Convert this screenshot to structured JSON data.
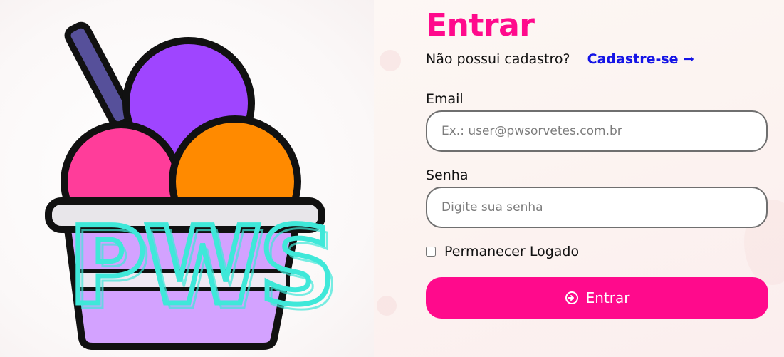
{
  "login": {
    "title": "Entrar",
    "signup_prompt": "Não possui cadastro?",
    "signup_link": "Cadastre-se",
    "signup_arrow": "➞",
    "email_label": "Email",
    "email_placeholder": "Ex.: user@pwsorvetes.com.br",
    "password_label": "Senha",
    "password_placeholder": "Digite sua senha",
    "remember_label": "Permanecer Logado",
    "remember_checked": false,
    "submit_label": "Entrar",
    "submit_icon": "login-icon"
  },
  "logo": {
    "text": "PWS",
    "description_icon": "ice-cream-cup-logo"
  },
  "colors": {
    "accent": "#ff0a8c",
    "link": "#1414e6",
    "scoop_purple": "#9f45ff",
    "scoop_pink": "#ff3d9a",
    "scoop_orange": "#ff8a00",
    "cup": "#d3a2ff",
    "logo_text": "#3fe8d9"
  }
}
